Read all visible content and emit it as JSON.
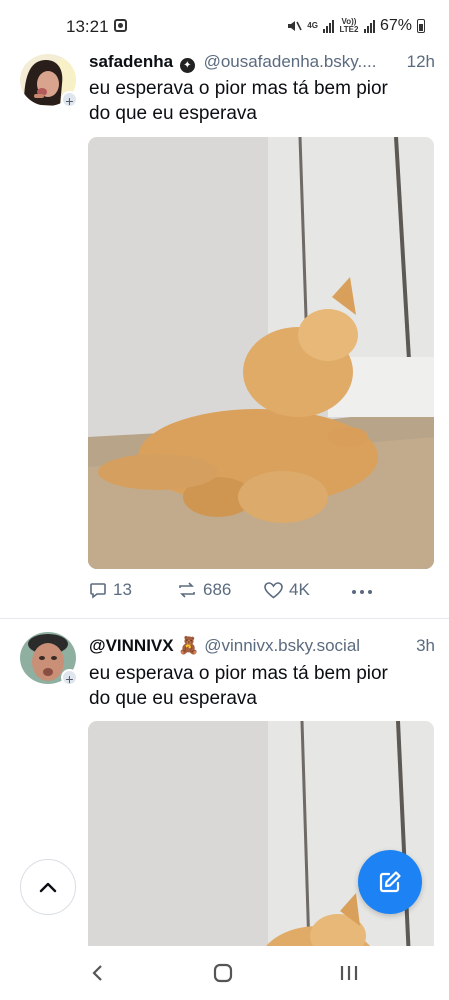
{
  "status_bar": {
    "time": "13:21",
    "network_label_1": "4G",
    "network_label_2": "Vo)) LTE2",
    "battery": "67%"
  },
  "posts": [
    {
      "display_name": "safadenha",
      "handle": "@ousafadenha.bsky....",
      "time_ago": "12h",
      "text_line1": "eu esperava o pior  mas tá bem pior",
      "text_line2": "do que eu esperava",
      "media": "cat-gif",
      "replies": "13",
      "reposts": "686",
      "likes": "4K"
    },
    {
      "display_name": "@VINNIVX",
      "display_name_emoji": "🧸",
      "handle": "@vinnivx.bsky.social",
      "time_ago": "3h",
      "text_line1": "eu esperava o pior  mas tá bem pior",
      "text_line2": "do que eu esperava",
      "media": "cat-gif"
    }
  ],
  "icons": {
    "reply": "chat-bubble-icon",
    "repost": "repost-arrows-icon",
    "like": "heart-icon",
    "more": "ellipsis-icon",
    "scroll_top": "chevron-up-icon",
    "compose": "compose-pencil-icon"
  },
  "colors": {
    "accent": "#1d83f5",
    "muted_text": "#5b6b7f"
  }
}
